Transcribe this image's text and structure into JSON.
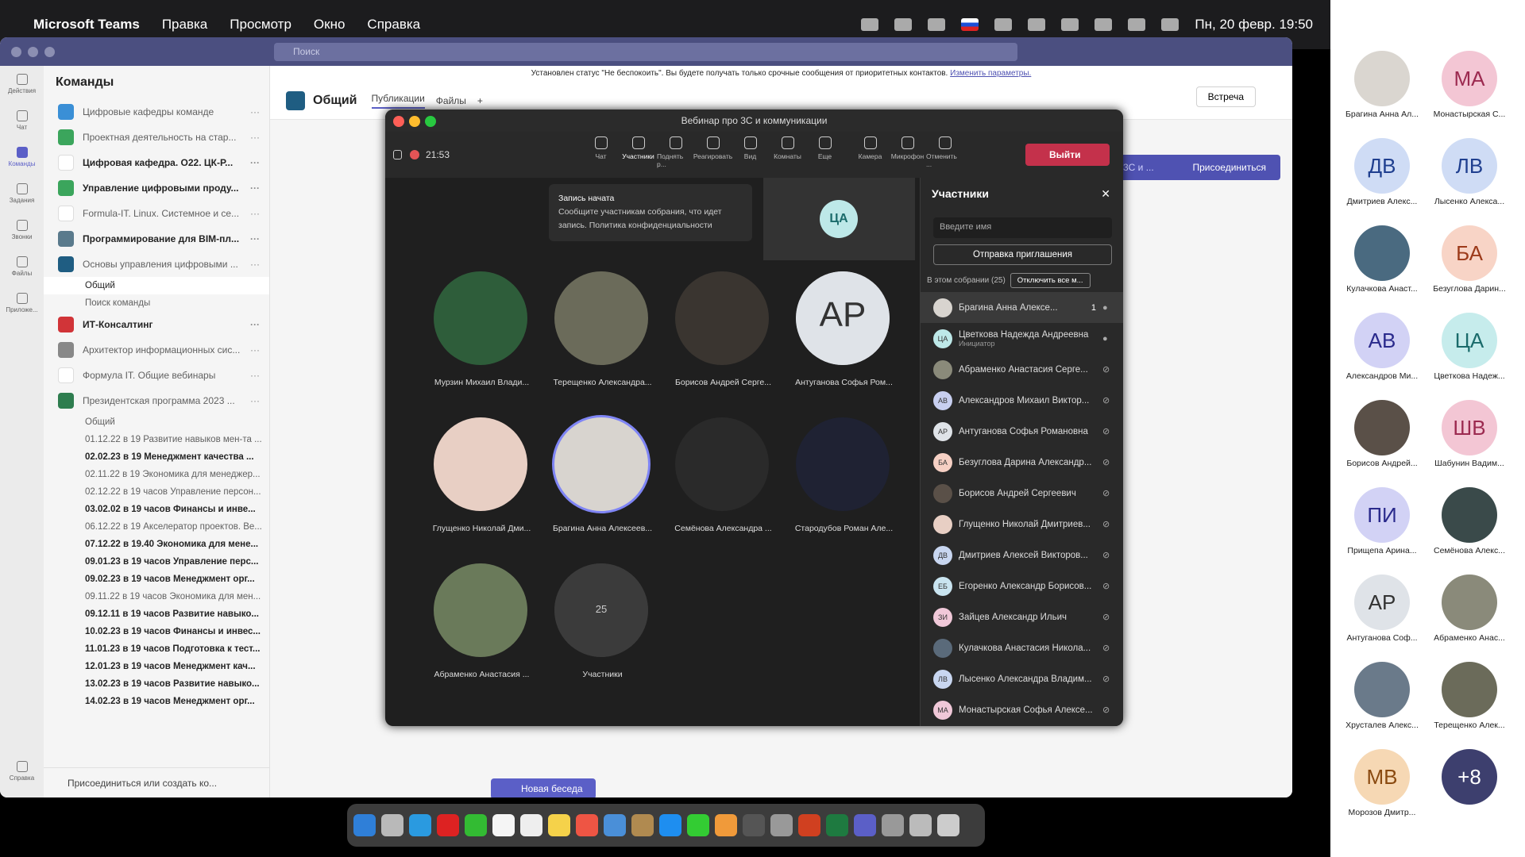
{
  "menubar": {
    "app": "Microsoft Teams",
    "items": [
      "Правка",
      "Просмотр",
      "Окно",
      "Справка"
    ],
    "datetime": "Пн, 20 февр. 19:50"
  },
  "teams": {
    "search_placeholder": "Поиск",
    "rail": [
      {
        "label": "Действия",
        "icon": "bell-icon"
      },
      {
        "label": "Чат",
        "icon": "chat-icon"
      },
      {
        "label": "Команды",
        "icon": "teams-icon"
      },
      {
        "label": "Задания",
        "icon": "assignments-icon"
      },
      {
        "label": "Звонки",
        "icon": "phone-icon"
      },
      {
        "label": "Файлы",
        "icon": "file-icon"
      },
      {
        "label": "Приложе...",
        "icon": "apps-icon"
      },
      {
        "label": "Справка",
        "icon": "help-icon"
      }
    ],
    "sidebar_title": "Команды",
    "teams_list": [
      {
        "name": "Цифровые кафедры команде",
        "color": "#3a8fd6",
        "bold": false
      },
      {
        "name": "Проектная деятельность на стар...",
        "color": "#3ba55c",
        "bold": false
      },
      {
        "name": "Цифровая кафедра. О22. ЦК-Р...",
        "color": "#ffffff",
        "bold": true
      },
      {
        "name": "Управление цифровыми проду...",
        "color": "#3ba55c",
        "bold": true
      },
      {
        "name": "Formula-IT. Linux. Системное и се...",
        "color": "#ffffff",
        "bold": false
      },
      {
        "name": "Программирование для BIM-пл...",
        "color": "#5a7a8c",
        "bold": true
      },
      {
        "name": "Основы управления цифровыми ...",
        "color": "#1f5d82",
        "bold": false
      }
    ],
    "channels_a": [
      {
        "name": "Общий",
        "bold": false,
        "selected": true
      },
      {
        "name": "Поиск команды",
        "bold": false,
        "selected": false
      }
    ],
    "teams_list2": [
      {
        "name": "ИТ-Консалтинг",
        "color": "#d13438",
        "bold": true
      },
      {
        "name": "Архитектор информационных сис...",
        "color": "#888888",
        "bold": false
      },
      {
        "name": "Формула IT. Общие вебинары",
        "color": "#ffffff",
        "bold": false
      },
      {
        "name": "Президентская программа 2023 ...",
        "color": "#2e7d4f",
        "bold": false
      }
    ],
    "channels_b": [
      {
        "name": "Общий",
        "bold": false
      },
      {
        "name": "01.12.22 в 19 Развитие навыков мен-та ...",
        "bold": false
      },
      {
        "name": "02.02.23 в 19 Менеджмент качества ...",
        "bold": true
      },
      {
        "name": "02.11.22 в 19 Экономика для менеджер...",
        "bold": false
      },
      {
        "name": "02.12.22 в 19 часов Управление персон...",
        "bold": false
      },
      {
        "name": "03.02.02 в 19 часов Финансы и инве...",
        "bold": true
      },
      {
        "name": "06.12.22 в 19 Акселератор проектов. Ве...",
        "bold": false
      },
      {
        "name": "07.12.22 в 19.40 Экономика для мене...",
        "bold": true
      },
      {
        "name": "09.01.23 в 19 часов Управление перс...",
        "bold": true
      },
      {
        "name": "09.02.23 в 19 часов Менеджмент орг...",
        "bold": true
      },
      {
        "name": "09.11.22 в 19 часов Экономика для мен...",
        "bold": false
      },
      {
        "name": "09.12.11 в 19 часов Развитие навыко...",
        "bold": true
      },
      {
        "name": "10.02.23 в 19 часов Финансы и инвес...",
        "bold": true
      },
      {
        "name": "11.01.23 в 19 часов Подготовка к тест...",
        "bold": true
      },
      {
        "name": "12.01.23 в 19 часов Менеджмент кач...",
        "bold": true
      },
      {
        "name": "13.02.23 в 19 часов Развитие навыко...",
        "bold": true
      },
      {
        "name": "14.02.23 в 19 часов Менеджмент орг...",
        "bold": true
      }
    ],
    "sidebar_footer": "Присоединиться или создать ко...",
    "notice_text": "Установлен статус \"Не беспокоить\". Вы будете получать только срочные сообщения от приоритетных контактов.",
    "notice_link": "Изменить параметры.",
    "channel_title": "Общий",
    "channel_tabs": [
      "Публикации",
      "Файлы"
    ],
    "meet_button": "Встреча",
    "join_banner_left": "3С и ...",
    "join_button": "Присоединиться",
    "new_conversation": "Новая беседа"
  },
  "call": {
    "title": "Вебинар про 3С и коммуникации",
    "timer": "21:53",
    "tools": [
      "Чат",
      "Участники",
      "Поднять р...",
      "Реагировать",
      "Вид",
      "Комнаты",
      "Еще",
      "Камера",
      "Микрофон",
      "Отменить ..."
    ],
    "leave_button": "Выйти",
    "recording_toast_title": "Запись начата",
    "recording_toast_body": "Сообщите участникам собрания, что идет запись. Политика конфиденциальности",
    "self_initials": "ЦА",
    "tiles": [
      {
        "name": "Мурзин Михаил Влади...",
        "initials": "",
        "color": "#2e5d3a"
      },
      {
        "name": "Терещенко Александра...",
        "initials": "",
        "color": "#6b6b5a"
      },
      {
        "name": "Борисов Андрей Серге...",
        "initials": "",
        "color": "#3a3530"
      },
      {
        "name": "Антуганова Софья Ром...",
        "initials": "АР",
        "color": "#dfe3e8"
      },
      {
        "name": "Глущенко Николай Дми...",
        "initials": "",
        "color": "#e8cfc4"
      },
      {
        "name": "Брагина Анна Алексеев...",
        "initials": "",
        "color": "#d8d4cf"
      },
      {
        "name": "Семёнова Александра ...",
        "initials": "",
        "color": "#2a2a2a"
      },
      {
        "name": "Стародубов Роман Але...",
        "initials": "",
        "color": "#1f2233"
      },
      {
        "name": "Абраменко Анастасия ...",
        "initials": "",
        "color": "#6a7a5a"
      },
      {
        "name": "Участники",
        "initials": "25",
        "color": "#3b3b3b"
      }
    ],
    "panel": {
      "title": "Участники",
      "search_placeholder": "Введите имя",
      "invite_button": "Отправка приглашения",
      "section": "В этом собрании (25)",
      "mute_all": "Отключить все м...",
      "people": [
        {
          "name": "Брагина Анна Алексе...",
          "initials": "",
          "badge": "1",
          "sub": "",
          "color": "#d8d4cf",
          "mic": "on"
        },
        {
          "name": "Цветкова Надежда Андреевна",
          "initials": "ЦА",
          "badge": "",
          "sub": "Инициатор",
          "color": "#bde8e8",
          "mic": "on"
        },
        {
          "name": "Абраменко Анастасия Серге...",
          "initials": "",
          "badge": "",
          "sub": "",
          "color": "#8a8a7a",
          "mic": "off"
        },
        {
          "name": "Александров Михаил Виктор...",
          "initials": "АВ",
          "badge": "",
          "sub": "",
          "color": "#c8cff0",
          "mic": "off"
        },
        {
          "name": "Антуганова Софья Романовна",
          "initials": "АР",
          "badge": "",
          "sub": "",
          "color": "#dfe3e8",
          "mic": "off"
        },
        {
          "name": "Безуглова Дарина Александр...",
          "initials": "БА",
          "badge": "",
          "sub": "",
          "color": "#f6d0c4",
          "mic": "off"
        },
        {
          "name": "Борисов Андрей Сергеевич",
          "initials": "",
          "badge": "",
          "sub": "",
          "color": "#5a5048",
          "mic": "off"
        },
        {
          "name": "Глущенко Николай Дмитриев...",
          "initials": "",
          "badge": "",
          "sub": "",
          "color": "#e8cfc4",
          "mic": "off"
        },
        {
          "name": "Дмитриев Алексей Викторов...",
          "initials": "ДВ",
          "badge": "",
          "sub": "",
          "color": "#c8d6f0",
          "mic": "off"
        },
        {
          "name": "Егоренко Александр Борисов...",
          "initials": "ЕБ",
          "badge": "",
          "sub": "",
          "color": "#c9e4f0",
          "mic": "off"
        },
        {
          "name": "Зайцев Александр Ильич",
          "initials": "ЗИ",
          "badge": "",
          "sub": "",
          "color": "#f0c8d8",
          "mic": "off"
        },
        {
          "name": "Кулачкова Анастасия Никола...",
          "initials": "",
          "badge": "",
          "sub": "",
          "color": "#5a6a7a",
          "mic": "off"
        },
        {
          "name": "Лысенко Александра Владим...",
          "initials": "ЛВ",
          "badge": "",
          "sub": "",
          "color": "#c8d6f0",
          "mic": "off"
        },
        {
          "name": "Монастырская Софья Алексе...",
          "initials": "МА",
          "badge": "",
          "sub": "",
          "color": "#f0c8d8",
          "mic": "off"
        }
      ]
    }
  },
  "gallery": [
    {
      "name": "Брагина Анна Ал...",
      "initials": "",
      "bg": "#dad6d0",
      "fg": "#222"
    },
    {
      "name": "Монастырская С...",
      "initials": "МА",
      "bg": "#f3c6d4",
      "fg": "#9c2a50"
    },
    {
      "name": "Дмитриев Алекс...",
      "initials": "ДВ",
      "bg": "#cfdcf5",
      "fg": "#1f3f8f"
    },
    {
      "name": "Лысенко Алекса...",
      "initials": "ЛВ",
      "bg": "#cfdcf5",
      "fg": "#1f3f8f"
    },
    {
      "name": "Кулачкова Анаст...",
      "initials": "",
      "bg": "#4a6a80",
      "fg": "#fff"
    },
    {
      "name": "Безуглова Дарин...",
      "initials": "БА",
      "bg": "#f8d4c6",
      "fg": "#9c3a1a"
    },
    {
      "name": "Александров Ми...",
      "initials": "АВ",
      "bg": "#d2d2f5",
      "fg": "#2a2a8c"
    },
    {
      "name": "Цветкова Надеж...",
      "initials": "ЦА",
      "bg": "#c6ecec",
      "fg": "#1a6b6b"
    },
    {
      "name": "Борисов Андрей...",
      "initials": "",
      "bg": "#5a5048",
      "fg": "#fff"
    },
    {
      "name": "Шабунин Вадим...",
      "initials": "ШВ",
      "bg": "#f3c6d4",
      "fg": "#9c2a50"
    },
    {
      "name": "Прищепа Арина...",
      "initials": "ПИ",
      "bg": "#d2d2f5",
      "fg": "#2a2a8c"
    },
    {
      "name": "Семёнова Алекс...",
      "initials": "",
      "bg": "#3a4a4a",
      "fg": "#fff"
    },
    {
      "name": "Антуганова Соф...",
      "initials": "АР",
      "bg": "#dfe3e8",
      "fg": "#333"
    },
    {
      "name": "Абраменко Анас...",
      "initials": "",
      "bg": "#8a8a7a",
      "fg": "#fff"
    },
    {
      "name": "Хрусталев Алекс...",
      "initials": "",
      "bg": "#6a7a8a",
      "fg": "#fff"
    },
    {
      "name": "Терещенко Алек...",
      "initials": "",
      "bg": "#6b6b5a",
      "fg": "#fff"
    },
    {
      "name": "Морозов Дмитр...",
      "initials": "МВ",
      "bg": "#f6d8b4",
      "fg": "#8a4a10"
    },
    {
      "name": "",
      "initials": "+8",
      "bg": "#3d3f6e",
      "fg": "#fff"
    }
  ],
  "dock_colors": [
    "#2f7fd8",
    "#b9b9b9",
    "#2a9ae0",
    "#d22",
    "#3b3",
    "#f5f5f5",
    "#eee",
    "#f5d24a",
    "#e54",
    "#4a8fd8",
    "#b08a50",
    "#1e8ef0",
    "#3c3",
    "#f09a3a",
    "#555",
    "#999",
    "#d04020",
    "#1e7a40",
    "#5b5fc7",
    "#999",
    "#bbb",
    "#ccc"
  ]
}
